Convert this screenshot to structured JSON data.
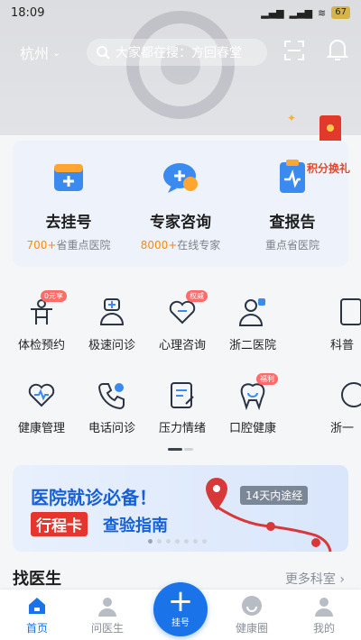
{
  "status_bar": {
    "time": "18:09",
    "battery": "67"
  },
  "header": {
    "city": "杭州",
    "search_placeholder": "大家都在搜：方回春堂"
  },
  "service_cards": [
    {
      "title": "去挂号",
      "num": "700+",
      "sub": "省重点医院",
      "icon": "calendar-icon"
    },
    {
      "title": "专家咨询",
      "num": "8000+",
      "sub": "在线专家",
      "icon": "chat-plus-icon"
    },
    {
      "title": "查报告",
      "num": "",
      "sub": "重点省医院",
      "icon": "report-icon"
    }
  ],
  "promo": {
    "label": "积分换礼"
  },
  "grid": [
    {
      "label": "体检预约",
      "icon": "body-check-icon",
      "tag": "0元享"
    },
    {
      "label": "极速问诊",
      "icon": "stethoscope-icon",
      "tag": ""
    },
    {
      "label": "心理咨询",
      "icon": "heart-chat-icon",
      "tag": "权威"
    },
    {
      "label": "浙二医院",
      "icon": "doctor-icon",
      "tag": ""
    },
    {
      "label": "科普",
      "icon": "article-icon",
      "tag": ""
    },
    {
      "label": "健康管理",
      "icon": "heart-pulse-icon",
      "tag": ""
    },
    {
      "label": "电话问诊",
      "icon": "phone-icon",
      "tag": ""
    },
    {
      "label": "压力情绪",
      "icon": "clipboard-icon",
      "tag": ""
    },
    {
      "label": "口腔健康",
      "icon": "tooth-icon",
      "tag": "福利"
    },
    {
      "label": "浙一",
      "icon": "hospital-icon",
      "tag": ""
    }
  ],
  "banner": {
    "title": "医院就诊必备！",
    "tag": "行程卡",
    "sub": "查验指南",
    "chip": "14天内途经",
    "slide_count": 7,
    "active_slide": 0
  },
  "find_doctor": {
    "title": "找医生",
    "more": "更多科室 ›"
  },
  "tabbar": {
    "items": [
      {
        "label": "首页",
        "icon": "home-icon",
        "active": true
      },
      {
        "label": "问医生",
        "icon": "doctor-avatar-icon",
        "active": false
      },
      {
        "label": "挂号",
        "icon": "plus-icon",
        "active": false
      },
      {
        "label": "健康圈",
        "icon": "circle-icon",
        "active": false
      },
      {
        "label": "我的",
        "icon": "user-icon",
        "active": false
      }
    ]
  },
  "colors": {
    "brand": "#1a73e8",
    "accent_orange": "#ff8a00",
    "promo_red": "#e5352c"
  }
}
